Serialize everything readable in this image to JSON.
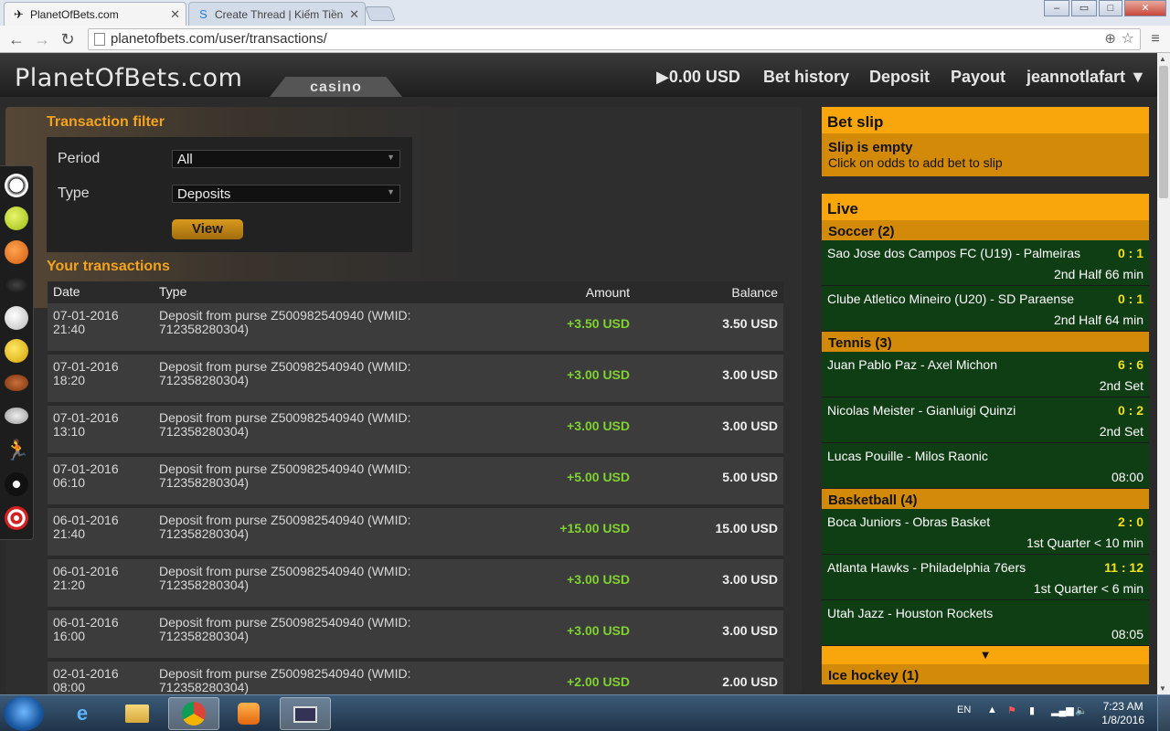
{
  "browser": {
    "tabs": [
      {
        "title": "PlanetOfBets.com",
        "active": true
      },
      {
        "title": "Create Thread | Kiếm Tiền",
        "active": false
      }
    ],
    "url": "planetofbets.com/user/transactions/"
  },
  "site": {
    "logo": "PlanetOfBets.com",
    "casino_tab": "casino",
    "balance": "▶0.00 USD",
    "nav": [
      "Bet history",
      "Deposit",
      "Payout"
    ],
    "user": "jeannotlafart ▼"
  },
  "filter": {
    "title": "Transaction filter",
    "period_label": "Period",
    "period_value": "All",
    "type_label": "Type",
    "type_value": "Deposits",
    "view_button": "View"
  },
  "transactions": {
    "title": "Your transactions",
    "columns": {
      "date": "Date",
      "type": "Type",
      "amount": "Amount",
      "balance": "Balance"
    },
    "rows": [
      {
        "date": "07-01-2016",
        "time": "21:40",
        "type1": "Deposit from purse Z500982540940 (WMID:",
        "type2": "712358280304)",
        "amount": "+3.50 USD",
        "balance": "3.50 USD"
      },
      {
        "date": "07-01-2016",
        "time": "18:20",
        "type1": "Deposit from purse Z500982540940 (WMID:",
        "type2": "712358280304)",
        "amount": "+3.00 USD",
        "balance": "3.00 USD"
      },
      {
        "date": "07-01-2016",
        "time": "13:10",
        "type1": "Deposit from purse Z500982540940 (WMID:",
        "type2": "712358280304)",
        "amount": "+3.00 USD",
        "balance": "3.00 USD"
      },
      {
        "date": "07-01-2016",
        "time": "06:10",
        "type1": "Deposit from purse Z500982540940 (WMID:",
        "type2": "712358280304)",
        "amount": "+5.00 USD",
        "balance": "5.00 USD"
      },
      {
        "date": "06-01-2016",
        "time": "21:40",
        "type1": "Deposit from purse Z500982540940 (WMID:",
        "type2": "712358280304)",
        "amount": "+15.00 USD",
        "balance": "15.00 USD"
      },
      {
        "date": "06-01-2016",
        "time": "21:20",
        "type1": "Deposit from purse Z500982540940 (WMID:",
        "type2": "712358280304)",
        "amount": "+3.00 USD",
        "balance": "3.00 USD"
      },
      {
        "date": "06-01-2016",
        "time": "16:00",
        "type1": "Deposit from purse Z500982540940 (WMID:",
        "type2": "712358280304)",
        "amount": "+3.00 USD",
        "balance": "3.00 USD"
      },
      {
        "date": "02-01-2016",
        "time": "08:00",
        "type1": "Deposit from purse Z500982540940 (WMID:",
        "type2": "712358280304)",
        "amount": "+2.00 USD",
        "balance": "2.00 USD"
      }
    ]
  },
  "sports_icons": [
    "soccer-icon",
    "tennis-icon",
    "basketball-icon",
    "hockey-icon",
    "volleyball-icon",
    "handball-icon",
    "american-football-icon",
    "rugby-icon",
    "athletics-icon",
    "snooker-icon",
    "darts-icon"
  ],
  "betslip": {
    "title": "Bet slip",
    "empty_title": "Slip is empty",
    "empty_text": "Click on odds to add bet to slip"
  },
  "live": {
    "title": "Live",
    "groups": [
      {
        "name": "Soccer (2)",
        "matches": [
          {
            "teams": "Sao Jose dos Campos FC (U19) - Palmeiras",
            "score": "0 : 1",
            "status": "2nd Half  66 min"
          },
          {
            "teams": "Clube Atletico Mineiro (U20) - SD Paraense",
            "score": "0 : 1",
            "status": "2nd Half  64 min"
          }
        ]
      },
      {
        "name": "Tennis (3)",
        "matches": [
          {
            "teams": "Juan Pablo Paz - Axel Michon",
            "score": "6 : 6",
            "status": "2nd Set"
          },
          {
            "teams": "Nicolas Meister - Gianluigi Quinzi",
            "score": "0 : 2",
            "status": "2nd Set"
          },
          {
            "teams": "Lucas Pouille - Milos Raonic",
            "score": "",
            "status": "08:00"
          }
        ]
      },
      {
        "name": "Basketball (4)",
        "matches": [
          {
            "teams": "Boca Juniors - Obras Basket",
            "score": "2 : 0",
            "status": "1st Quarter  < 10 min"
          },
          {
            "teams": "Atlanta Hawks - Philadelphia 76ers",
            "score": "11 : 12",
            "status": "1st Quarter  < 6 min"
          },
          {
            "teams": "Utah Jazz - Houston Rockets",
            "score": "",
            "status": "08:05"
          }
        ]
      }
    ],
    "expand": "▼",
    "next_group": "Ice hockey (1)"
  },
  "taskbar": {
    "lang": "EN",
    "time": "7:23 AM",
    "date": "1/8/2016"
  }
}
